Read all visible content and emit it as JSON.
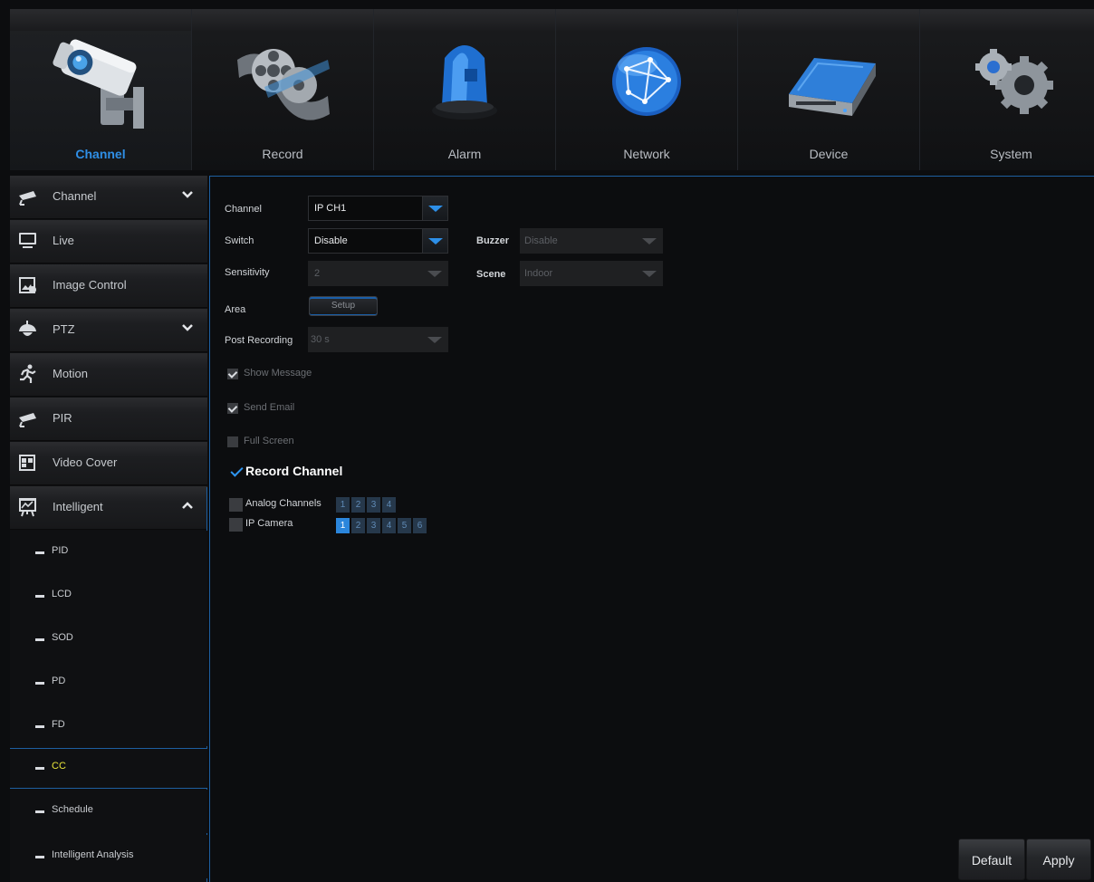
{
  "tabs": [
    {
      "label": "Channel",
      "icon": "camera-icon",
      "active": true
    },
    {
      "label": "Record",
      "icon": "film-reel-icon",
      "active": false
    },
    {
      "label": "Alarm",
      "icon": "siren-icon",
      "active": false
    },
    {
      "label": "Network",
      "icon": "globe-icon",
      "active": false
    },
    {
      "label": "Device",
      "icon": "hard-drive-icon",
      "active": false
    },
    {
      "label": "System",
      "icon": "gears-icon",
      "active": false
    }
  ],
  "sidebar": {
    "items": [
      {
        "label": "Channel",
        "icon": "camera-icon",
        "chevron": "down"
      },
      {
        "label": "Live",
        "icon": "monitor-icon"
      },
      {
        "label": "Image Control",
        "icon": "image-icon"
      },
      {
        "label": "PTZ",
        "icon": "ptz-dome-icon",
        "chevron": "down"
      },
      {
        "label": "Motion",
        "icon": "running-man-icon"
      },
      {
        "label": "PIR",
        "icon": "camera-icon"
      },
      {
        "label": "Video Cover",
        "icon": "video-cover-icon"
      },
      {
        "label": "Intelligent",
        "icon": "intelligent-icon",
        "chevron": "up"
      }
    ],
    "sub_items": [
      {
        "label": "PID",
        "active": false
      },
      {
        "label": "LCD",
        "active": false
      },
      {
        "label": "SOD",
        "active": false
      },
      {
        "label": "PD",
        "active": false
      },
      {
        "label": "FD",
        "active": false
      },
      {
        "label": "CC",
        "active": true
      },
      {
        "label": "Schedule",
        "active": false
      },
      {
        "label": "Intelligent Analysis",
        "active": false
      }
    ]
  },
  "form": {
    "channel_label": "Channel",
    "channel_value": "IP CH1",
    "switch_label": "Switch",
    "switch_value": "Disable",
    "buzzer_label": "Buzzer",
    "buzzer_value": "Disable",
    "sensitivity_label": "Sensitivity",
    "sensitivity_value": "2",
    "scene_label": "Scene",
    "scene_value": "Indoor",
    "area_label": "Area",
    "setup_label": "Setup",
    "post_recording_label": "Post Recording",
    "post_recording_value": "30 s",
    "show_message_label": "Show Message",
    "show_message_checked": true,
    "send_email_label": "Send Email",
    "send_email_checked": true,
    "full_screen_label": "Full Screen",
    "full_screen_checked": false,
    "record_channel_label": "Record Channel",
    "record_channel_checked": true,
    "analog_channels_label": "Analog Channels",
    "analog_channels": [
      "1",
      "2",
      "3",
      "4"
    ],
    "ip_camera_label": "IP Camera",
    "ip_cameras": [
      "1",
      "2",
      "3",
      "4",
      "5",
      "6"
    ],
    "ip_camera_selected": [
      "1"
    ]
  },
  "footer": {
    "default_label": "Default",
    "apply_label": "Apply"
  },
  "colors": {
    "accent": "#2f8fe6",
    "active_sub": "#e8e43a",
    "panel_border": "#1e5fa0"
  }
}
